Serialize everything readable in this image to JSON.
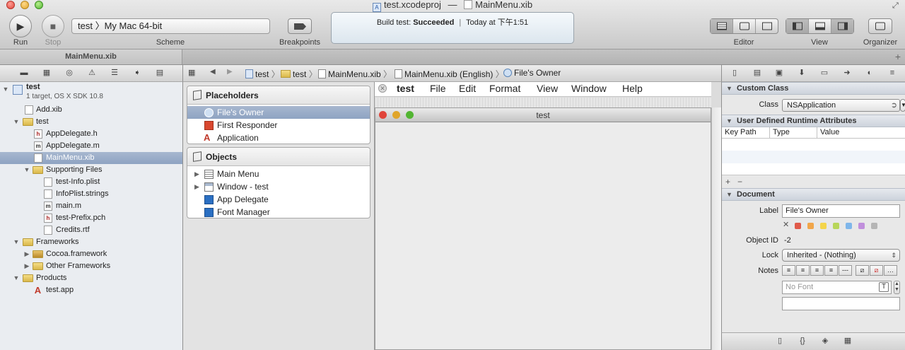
{
  "window": {
    "title_project": "test.xcodeproj",
    "title_sep": "—",
    "title_file": "MainMenu.xib"
  },
  "toolbar": {
    "run_label": "Run",
    "stop_label": "Stop",
    "scheme_text": "test 〉My Mac 64-bit",
    "scheme_label": "Scheme",
    "breakpoints_label": "Breakpoints",
    "activity_prefix": "Build test: ",
    "activity_status": "Succeeded",
    "activity_sep": "|",
    "activity_time": "Today at 下午1:51",
    "editor_label": "Editor",
    "view_label": "View",
    "organizer_label": "Organizer"
  },
  "tabs": [
    {
      "label": "MainMenu.xib"
    }
  ],
  "navigator": {
    "tree": [
      {
        "label": "test",
        "sub": "1 target, OS X SDK 10.8"
      },
      {
        "label": "Add.xib"
      },
      {
        "label": "test"
      },
      {
        "label": "AppDelegate.h"
      },
      {
        "label": "AppDelegate.m"
      },
      {
        "label": "MainMenu.xib"
      },
      {
        "label": "Supporting Files"
      },
      {
        "label": "test-Info.plist"
      },
      {
        "label": "InfoPlist.strings"
      },
      {
        "label": "main.m"
      },
      {
        "label": "test-Prefix.pch"
      },
      {
        "label": "Credits.rtf"
      },
      {
        "label": "Frameworks"
      },
      {
        "label": "Cocoa.framework"
      },
      {
        "label": "Other Frameworks"
      },
      {
        "label": "Products"
      },
      {
        "label": "test.app"
      }
    ]
  },
  "jumpbar": {
    "crumbs": [
      "test",
      "test",
      "MainMenu.xib",
      "MainMenu.xib (English)",
      "File's Owner"
    ]
  },
  "outline": {
    "placeholders_title": "Placeholders",
    "placeholders": [
      "File's Owner",
      "First Responder",
      "Application"
    ],
    "objects_title": "Objects",
    "objects": [
      "Main Menu",
      "Window - test",
      "App Delegate",
      "Font Manager"
    ]
  },
  "canvas": {
    "menu": [
      "test",
      "File",
      "Edit",
      "Format",
      "View",
      "Window",
      "Help"
    ],
    "window_title": "test"
  },
  "inspector": {
    "custom_class_title": "Custom Class",
    "class_label": "Class",
    "class_value": "NSApplication",
    "runtime_title": "User Defined Runtime Attributes",
    "col_keypath": "Key Path",
    "col_type": "Type",
    "col_value": "Value",
    "document_title": "Document",
    "label_label": "Label",
    "label_value": "File's Owner",
    "objectid_label": "Object ID",
    "objectid_value": "-2",
    "lock_label": "Lock",
    "lock_value": "Inherited - (Nothing)",
    "notes_label": "Notes",
    "font_placeholder": "No Font",
    "swatch_colors": [
      "#e05a4a",
      "#f1a64a",
      "#f4d54b",
      "#b8d65a",
      "#7fb6ea",
      "#c08fdc",
      "#b5b5b5"
    ]
  }
}
